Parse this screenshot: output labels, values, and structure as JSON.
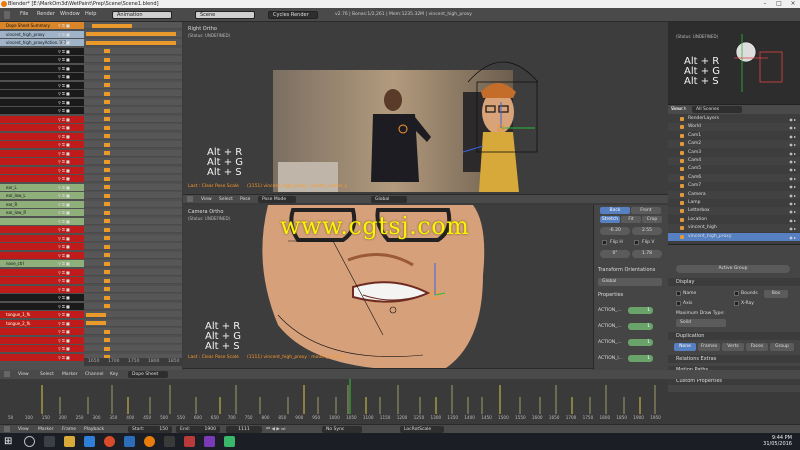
{
  "titlebar": {
    "text": "Blender* [E:\\MarkOm3d\\WetPaint\\Prep\\Scene\\Scene1.blend]"
  },
  "menubar": {
    "items": [
      "File",
      "Render",
      "Window",
      "Help"
    ],
    "editor_type": "Animation",
    "scene": "Scene",
    "engine": "Cycles Render",
    "stats": "v2.76 | Bones:1/2,261 | Mem:1235.32M | vincent_high_proxy"
  },
  "dopesheet": {
    "channels": [
      {
        "label": "Dope Sheet Summary",
        "kind": "sum"
      },
      {
        "label": "vincent_high_proxy",
        "kind": "obj"
      },
      {
        "label": "vincent_high_proxyAction.002",
        "kind": "obj"
      },
      {
        "label": "",
        "kind": "black"
      },
      {
        "label": "",
        "kind": "black"
      },
      {
        "label": "",
        "kind": "black"
      },
      {
        "label": "",
        "kind": "black"
      },
      {
        "label": "",
        "kind": "black"
      },
      {
        "label": "",
        "kind": "black"
      },
      {
        "label": "",
        "kind": "black"
      },
      {
        "label": "",
        "kind": "black"
      },
      {
        "label": "",
        "kind": "red"
      },
      {
        "label": "",
        "kind": "red"
      },
      {
        "label": "",
        "kind": "red"
      },
      {
        "label": "",
        "kind": "red"
      },
      {
        "label": "",
        "kind": "red"
      },
      {
        "label": "",
        "kind": "red"
      },
      {
        "label": "",
        "kind": "red"
      },
      {
        "label": "",
        "kind": "red"
      },
      {
        "label": "ear_L",
        "kind": "green"
      },
      {
        "label": "ear_low_L",
        "kind": "green"
      },
      {
        "label": "ear_R",
        "kind": "green"
      },
      {
        "label": "ear_low_R",
        "kind": "green"
      },
      {
        "label": "",
        "kind": "green"
      },
      {
        "label": "",
        "kind": "red"
      },
      {
        "label": "",
        "kind": "red"
      },
      {
        "label": "",
        "kind": "red"
      },
      {
        "label": "",
        "kind": "red"
      },
      {
        "label": "nose_ctrl",
        "kind": "green"
      },
      {
        "label": "",
        "kind": "red"
      },
      {
        "label": "",
        "kind": "red"
      },
      {
        "label": "",
        "kind": "red"
      },
      {
        "label": "",
        "kind": "black"
      },
      {
        "label": "",
        "kind": "black"
      },
      {
        "label": "tongue_1_fk",
        "kind": "red"
      },
      {
        "label": "tongue_2_fk",
        "kind": "red"
      },
      {
        "label": "",
        "kind": "red"
      },
      {
        "label": "",
        "kind": "red"
      },
      {
        "label": "",
        "kind": "red"
      },
      {
        "label": "",
        "kind": "red"
      }
    ],
    "ruler": [
      "1650",
      "1700",
      "1750",
      "1800",
      "1850"
    ],
    "header_items": [
      "View",
      "Select",
      "Marker",
      "Channel",
      "Key"
    ],
    "mode": "Dope Sheet"
  },
  "viewport_top": {
    "label": "Right Ortho",
    "sub": "(Status: UNDEFINED)",
    "hotkeys": [
      "Alt + R",
      "Alt + G",
      "Alt + S"
    ],
    "last_op": "Last : Clear Pose Scale",
    "bone": "(1151) vincent_high_proxy : mouth_corner_L",
    "header_items": [
      "View",
      "Select",
      "Pose"
    ],
    "mode": "Pose Mode",
    "pivot": "Global"
  },
  "viewport_bottom": {
    "label": "Camera Ortho",
    "sub": "(Status: UNDEFINED)",
    "hotkeys": [
      "Alt + R",
      "Alt + G",
      "Alt + S"
    ],
    "last_op": "Last : Clear Pose Scale",
    "bone": "(1111) vincent_high_proxy : mouth_corner_L",
    "header_items": [
      "View",
      "Select",
      "Pose"
    ],
    "mode": "Pose Mode",
    "pivot": "Global"
  },
  "viewport_cam": {
    "sub": "(Status: UNDEFINED)",
    "hotkeys": [
      "Alt + R",
      "Alt + G",
      "Alt + S"
    ]
  },
  "sidepanel": {
    "back": "Back",
    "front": "Front",
    "stretch": "Stretch",
    "fit": "Fit",
    "crop": "Crop",
    "x": "-6.20",
    "y": "2.55",
    "flip_h": "Flip H",
    "flip_v": "Flip V",
    "rot": "0°",
    "scale": "1.78",
    "orient_head": "Transform Orientations",
    "orient": "Global",
    "props_head": "Properties",
    "actions": [
      {
        "label": "ACTION_...",
        "value": "1"
      },
      {
        "label": "ACTION_...",
        "value": "1"
      },
      {
        "label": "ACTION_...",
        "value": "1"
      },
      {
        "label": "ACTION_l...",
        "value": "1"
      }
    ]
  },
  "outliner": {
    "header": [
      "View",
      "Search",
      "All Scenes"
    ],
    "rows": [
      {
        "label": "RenderLayers",
        "kind": "normal"
      },
      {
        "label": "World",
        "kind": "alt"
      },
      {
        "label": "Cam1",
        "kind": "normal"
      },
      {
        "label": "Cam2",
        "kind": "alt"
      },
      {
        "label": "Cam3",
        "kind": "normal"
      },
      {
        "label": "Cam4",
        "kind": "alt"
      },
      {
        "label": "Cam5",
        "kind": "normal"
      },
      {
        "label": "Cam6",
        "kind": "alt"
      },
      {
        "label": "Cam7",
        "kind": "normal"
      },
      {
        "label": "Camera",
        "kind": "alt"
      },
      {
        "label": "Lamp",
        "kind": "normal"
      },
      {
        "label": "Letterbox",
        "kind": "alt"
      },
      {
        "label": "Location",
        "kind": "normal"
      },
      {
        "label": "vincent_high",
        "kind": "alt"
      },
      {
        "label": "vincent_high_proxy",
        "kind": "sel"
      }
    ]
  },
  "props": {
    "search_ph": "Active Group",
    "display": "Display",
    "name": "Name",
    "bounds": "Bounds",
    "box": "Box",
    "axis": "Axis",
    "xray": "X-Ray",
    "max_draw": "Maximum Draw Type:",
    "draw_type": "Solid",
    "duplication": "Duplication",
    "dup_btns": [
      "None",
      "Frames",
      "Verts",
      "Faces",
      "Group"
    ],
    "relations": "Relations Extras",
    "motion_paths": "Motion Paths",
    "custom": "Custom Properties"
  },
  "timeline": {
    "header_items": [
      "View",
      "Select",
      "Marker",
      "Channel",
      "Key"
    ],
    "mode": "Dope Sheet",
    "numbers": [
      "50",
      "100",
      "150",
      "200",
      "250",
      "300",
      "350",
      "400",
      "450",
      "500",
      "550",
      "600",
      "650",
      "700",
      "750",
      "800",
      "850",
      "900",
      "950",
      "1000",
      "1050",
      "1100",
      "1150",
      "1200",
      "1250",
      "1300",
      "1350",
      "1400",
      "1450",
      "1500",
      "1550",
      "1600",
      "1650",
      "1700",
      "1750",
      "1800",
      "1850",
      "1900",
      "1950"
    ],
    "pb_items": [
      "View",
      "Marker",
      "Frame",
      "Playback"
    ],
    "start": "Start:",
    "start_val": "150",
    "end": "End:",
    "end_val": "1900",
    "current": "1111",
    "sync": "No Sync",
    "keyset": "LocRotScale"
  },
  "taskbar": {
    "time": "9:44 PM",
    "date": "31/05/2016"
  },
  "watermark": "www.cgtsj.com",
  "colors": {
    "accent": "#5680c2",
    "key": "#e99a2a",
    "watermark": "#fff20a"
  }
}
